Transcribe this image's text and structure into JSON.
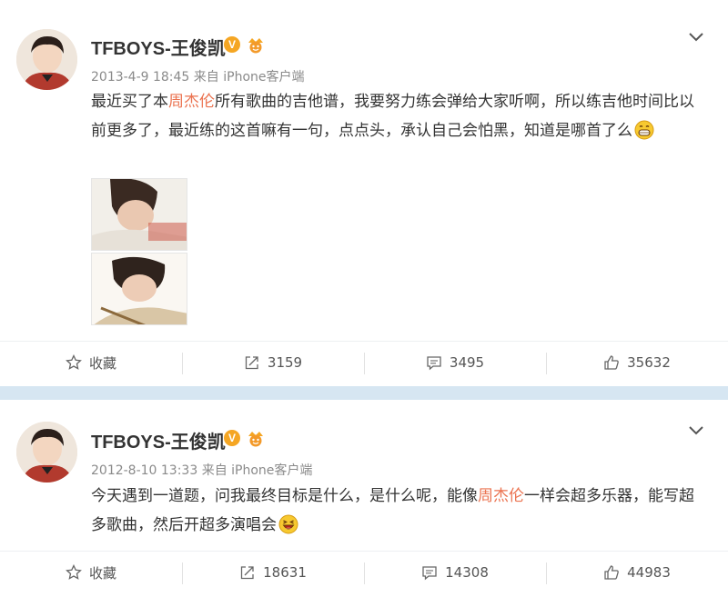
{
  "posts": [
    {
      "username": "TFBOYS-王俊凯",
      "verified_label": "V",
      "timestamp": "2013-4-9 18:45",
      "source": "来自 iPhone客户端",
      "text": {
        "p1": "最近买了本",
        "mention": "周杰伦",
        "p2": "所有歌曲的吉他谱，我要努力练会弹给大家听啊，所以练吉他时间比以前更多了，最近练的这首嘛有一句，点点头，承认自己会怕黑，知道是哪首了么"
      },
      "emoji": "grin-emoji",
      "actions": {
        "favorite": "收藏",
        "repost": "3159",
        "comments": "3495",
        "likes": "35632"
      }
    },
    {
      "username": "TFBOYS-王俊凯",
      "verified_label": "V",
      "timestamp": "2012-8-10 13:33",
      "source": "来自 iPhone客户端",
      "text": {
        "p1": "今天遇到一道题，问我最终目标是什么，是什么呢，能像",
        "mention": "周杰伦",
        "p2": "一样会超多乐器，能写超多歌曲，然后开超多演唱会"
      },
      "emoji": "laughing-emoji",
      "actions": {
        "favorite": "收藏",
        "repost": "18631",
        "comments": "14308",
        "likes": "44983"
      }
    }
  ],
  "colors": {
    "mention": "#eb7350",
    "badge": "#f5a623",
    "background": "#d6e6f2"
  }
}
